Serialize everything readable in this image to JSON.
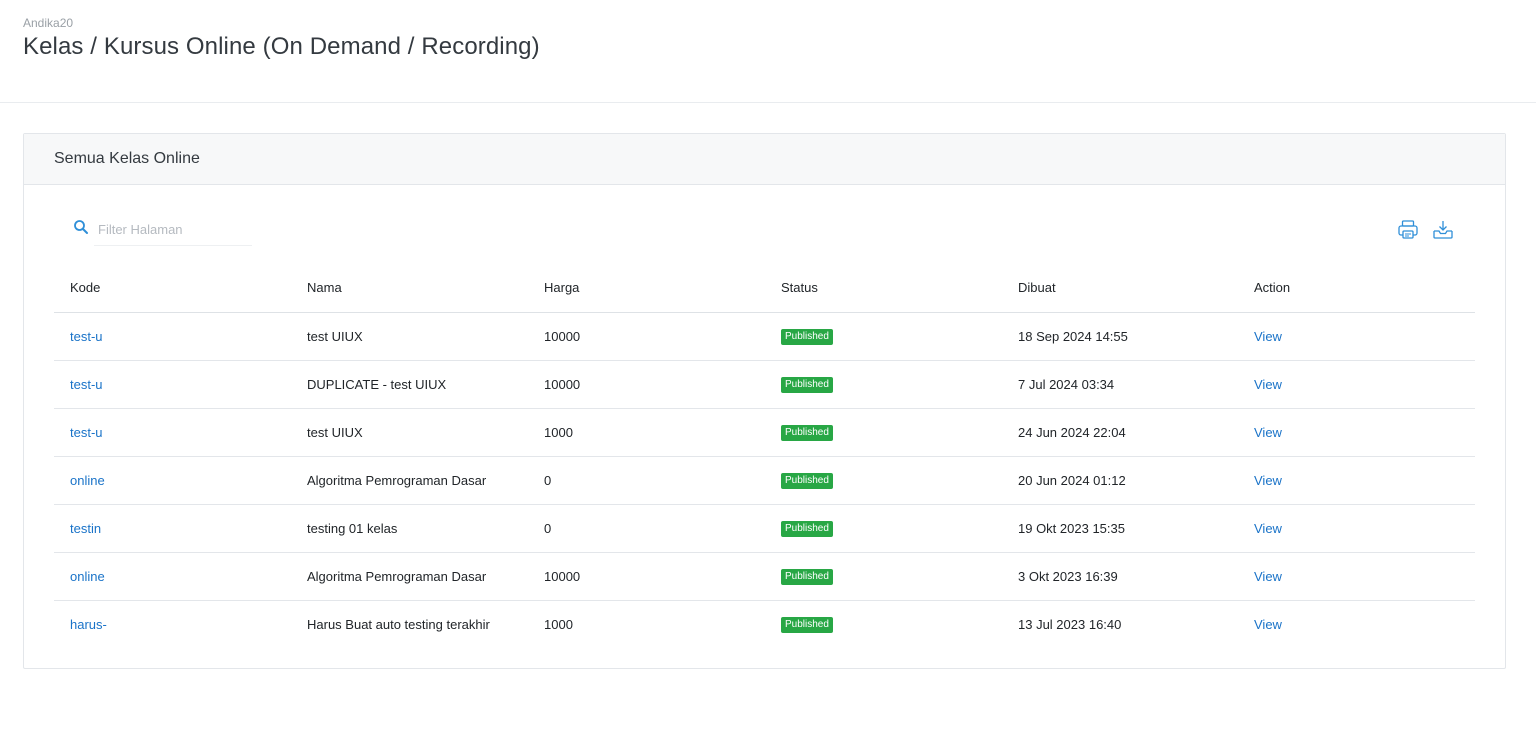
{
  "header": {
    "breadcrumb": "Andika20",
    "title": "Kelas / Kursus Online (On Demand / Recording)"
  },
  "card": {
    "title": "Semua Kelas Online"
  },
  "search": {
    "placeholder": "Filter Halaman",
    "value": ""
  },
  "toolbar": {
    "print_icon": "printer-icon",
    "download_icon": "download-icon"
  },
  "table": {
    "columns": [
      "Kode",
      "Nama",
      "Harga",
      "Status",
      "Dibuat",
      "Action"
    ],
    "rows": [
      {
        "kode": "test-u",
        "nama": "test UIUX",
        "harga": "10000",
        "status": "Published",
        "dibuat": "18 Sep 2024 14:55",
        "action": "View"
      },
      {
        "kode": "test-u",
        "nama": "DUPLICATE - test UIUX",
        "harga": "10000",
        "status": "Published",
        "dibuat": "7 Jul 2024 03:34",
        "action": "View"
      },
      {
        "kode": "test-u",
        "nama": "test UIUX",
        "harga": "1000",
        "status": "Published",
        "dibuat": "24 Jun 2024 22:04",
        "action": "View"
      },
      {
        "kode": "online",
        "nama": "Algoritma Pemrograman Dasar",
        "harga": "0",
        "status": "Published",
        "dibuat": "20 Jun 2024 01:12",
        "action": "View"
      },
      {
        "kode": "testin",
        "nama": "testing 01 kelas",
        "harga": "0",
        "status": "Published",
        "dibuat": "19 Okt 2023 15:35",
        "action": "View"
      },
      {
        "kode": "online",
        "nama": "Algoritma Pemrograman Dasar",
        "harga": "10000",
        "status": "Published",
        "dibuat": "3 Okt 2023 16:39",
        "action": "View"
      },
      {
        "kode": "harus-",
        "nama": "Harus Buat auto testing terakhir",
        "harga": "1000",
        "status": "Published",
        "dibuat": "13 Jul 2023 16:40",
        "action": "View"
      }
    ]
  },
  "colors": {
    "link": "#1a73c8",
    "badge_published": "#28a745",
    "icon_accent": "#2f8fd8"
  }
}
